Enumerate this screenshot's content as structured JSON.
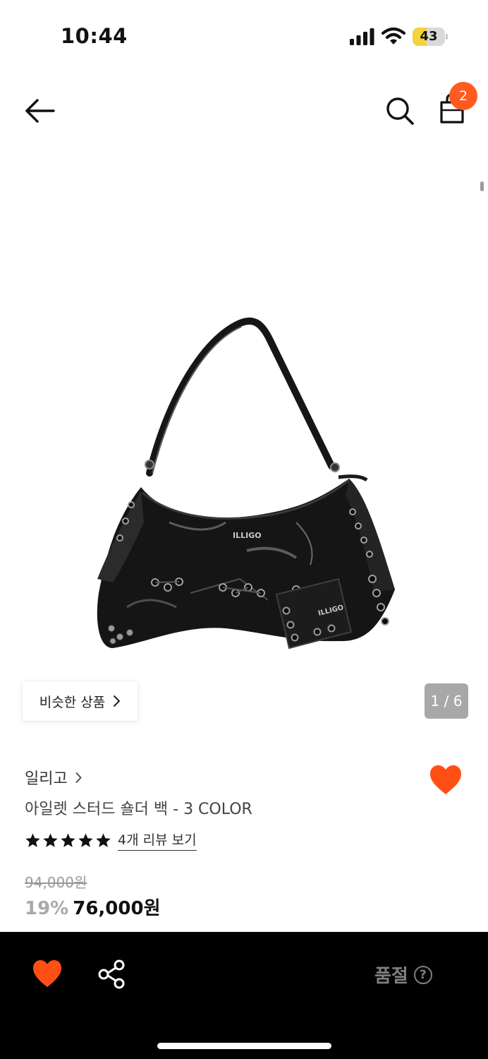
{
  "status_bar": {
    "time": "10:44",
    "battery_level": "43",
    "battery_color": "#f6d33c"
  },
  "nav": {
    "back_icon": "arrow-left-icon",
    "search_icon": "search-icon",
    "cart_icon": "shopping-bag-icon",
    "cart_count": "2",
    "badge_color": "#ff5a1f"
  },
  "gallery": {
    "similar_label": "비슷한 상품",
    "pager": "1 / 6"
  },
  "product": {
    "brand": "일리고",
    "title": "아일렛 스터드 숄더 백 - 3 COLOR",
    "rating": 5,
    "review_link": "4개 리뷰 보기",
    "original_price": "94,000원",
    "discount": "19%",
    "sale_price": "76,000원",
    "logo_text": "ILLIGO",
    "accent_color": "#ff4f14"
  },
  "bottom_bar": {
    "heart_icon": "heart-icon",
    "share_icon": "share-icon",
    "soldout_label": "품절",
    "help_icon": "?"
  }
}
